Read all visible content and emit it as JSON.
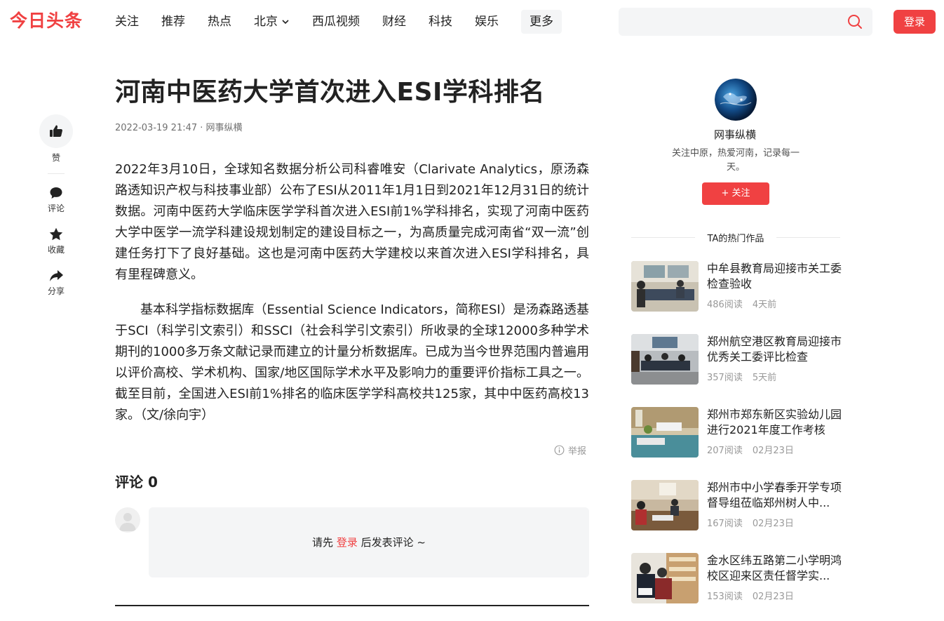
{
  "header": {
    "logo": "今日头条",
    "nav": [
      {
        "label": "关注"
      },
      {
        "label": "推荐"
      },
      {
        "label": "热点"
      },
      {
        "label": "北京"
      },
      {
        "label": "西瓜视频"
      },
      {
        "label": "财经"
      },
      {
        "label": "科技"
      },
      {
        "label": "娱乐"
      },
      {
        "label": "更多"
      }
    ],
    "search_placeholder": "",
    "login_label": "登录"
  },
  "actions": {
    "like": "赞",
    "comment": "评论",
    "collect": "收藏",
    "share": "分享"
  },
  "article": {
    "title": "河南中医药大学首次进入ESI学科排名",
    "meta": "2022-03-19 21:47 · 网事纵横",
    "paragraphs": [
      "2022年3月10日，全球知名数据分析公司科睿唯安（Clarivate Analytics，原汤森路透知识产权与科技事业部）公布了ESI从2011年1月1日到2021年12月31日的统计数据。河南中医药大学临床医学学科首次进入ESI前1%学科排名，实现了河南中医药大学中医学一流学科建设规划制定的建设目标之一，为高质量完成河南省“双一流”创建任务打下了良好基础。这也是河南中医药大学建校以来首次进入ESI学科排名，具有里程碑意义。",
      "基本科学指标数据库（Essential Science Indicators，简称ESI）是汤森路透基于SCI（科学引文索引）和SSCI（社会科学引文索引）所收录的全球12000多种学术期刊的1000多万条文献记录而建立的计量分析数据库。已成为当今世界范围内普遍用以评价高校、学术机构、国家/地区国际学术水平及影响力的重要评价指标工具之一。截至目前，全国进入ESI前1%排名的临床医学学科高校共125家，其中中医药高校13家。（文/徐向宇）"
    ],
    "report": "举报"
  },
  "comments": {
    "title": "评论 0",
    "prompt_prefix": "请先 ",
    "prompt_link": "登录",
    "prompt_suffix": " 后发表评论 ~"
  },
  "sidebar": {
    "author_name": "网事纵横",
    "author_desc": "关注中原，热爱河南，记录每一天。",
    "follow_label": "+ 关注",
    "hot_title": "TA的热门作品",
    "hot": [
      {
        "title": "中牟县教育局迎接市关工委检查验收",
        "reads": "486阅读",
        "time": "4天前"
      },
      {
        "title": "郑州航空港区教育局迎接市优秀关工委评比检查",
        "reads": "357阅读",
        "time": "5天前"
      },
      {
        "title": "郑州市郑东新区实验幼儿园进行2021年度工作考核",
        "reads": "207阅读",
        "time": "02月23日"
      },
      {
        "title": "郑州市中小学春季开学专项督导组莅临郑州树人中...",
        "reads": "167阅读",
        "time": "02月23日"
      },
      {
        "title": "金水区纬五路第二小学明鸿校区迎来区责任督学实...",
        "reads": "153阅读",
        "time": "02月23日"
      }
    ]
  },
  "colors": {
    "brand": "#f04142",
    "text": "#222222",
    "muted": "#999999",
    "panel": "#f4f5f6"
  }
}
